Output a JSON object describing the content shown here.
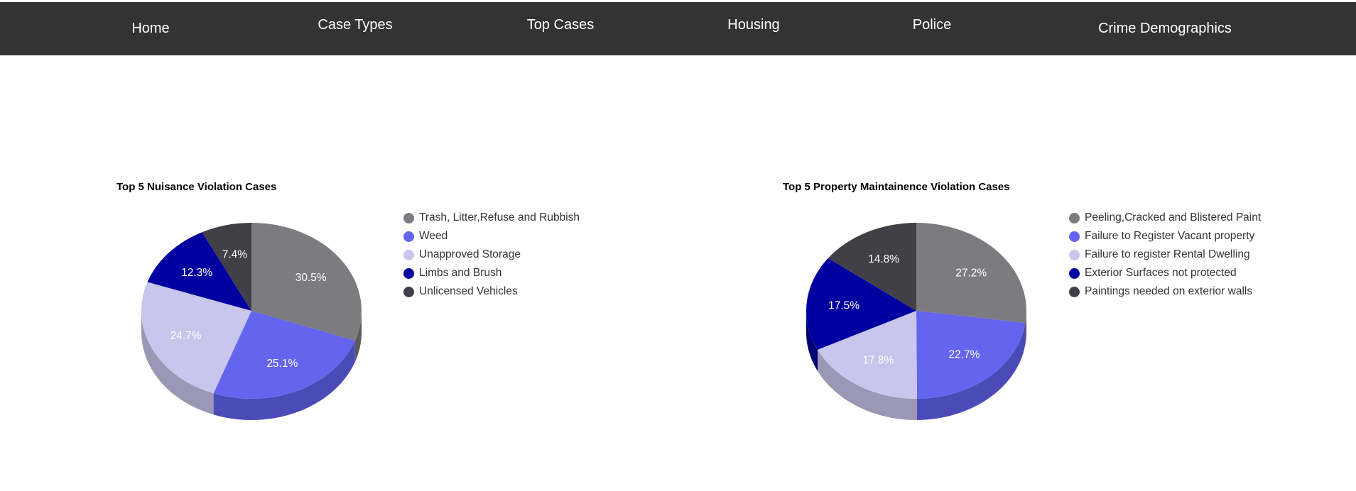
{
  "nav": {
    "home": "Home",
    "case_types": "Case Types",
    "top_cases": "Top Cases",
    "housing": "Housing",
    "police": "Police",
    "crime_demographics": "Crime Demographics"
  },
  "colors": {
    "nav_bg": "#333333",
    "slices": [
      "#7c7b80",
      "#6464ee",
      "#c8c6ec",
      "#0000a0",
      "#414049"
    ],
    "sides": [
      "#5a5a5e",
      "#4b4bb8",
      "#9a98b4",
      "#000074",
      "#2f2e35"
    ]
  },
  "chart_data": [
    {
      "type": "pie",
      "title": "Top 5 Nuisance Violation Cases",
      "categories": [
        "Trash, Litter,Refuse and Rubbish",
        "Weed",
        "Unapproved Storage",
        "Limbs and Brush",
        "Unlicensed Vehicles"
      ],
      "values": [
        30.5,
        25.1,
        24.7,
        12.3,
        7.4
      ],
      "labels": [
        "30.5%",
        "25.1%",
        "24.7%",
        "12.3%",
        "7.4%"
      ],
      "legend": "right",
      "style": "3d"
    },
    {
      "type": "pie",
      "title": "Top 5 Property Maintainence Violation Cases",
      "categories": [
        "Peeling,Cracked and Blistered Paint",
        "Failure to Register Vacant property",
        "Failure to register Rental Dwelling",
        "Exterior Surfaces not protected",
        "Paintings needed on exterior walls"
      ],
      "values": [
        27.2,
        22.7,
        17.8,
        17.5,
        14.8
      ],
      "labels": [
        "27.2%",
        "22.7%",
        "17.8%",
        "17.5%",
        "14.8%"
      ],
      "legend": "right",
      "style": "3d"
    }
  ]
}
